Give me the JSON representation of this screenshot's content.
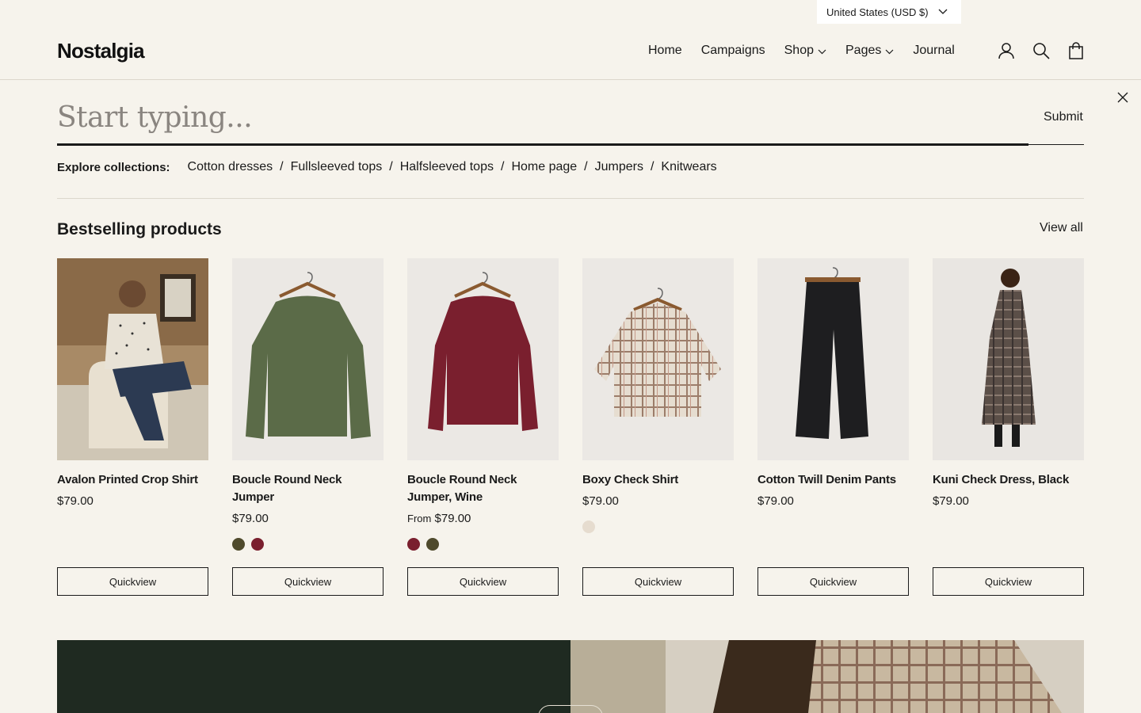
{
  "topbar": {
    "currency": "United States (USD $)"
  },
  "header": {
    "logo": "Nostalgia",
    "nav": [
      {
        "label": "Home",
        "dropdown": false
      },
      {
        "label": "Campaigns",
        "dropdown": false
      },
      {
        "label": "Shop",
        "dropdown": true
      },
      {
        "label": "Pages",
        "dropdown": true
      },
      {
        "label": "Journal",
        "dropdown": false
      }
    ],
    "icons": [
      "user-icon",
      "search-icon",
      "bag-icon"
    ]
  },
  "search": {
    "placeholder": "Start typing...",
    "submit_label": "Submit",
    "explore_label": "Explore collections:",
    "collections": [
      "Cotton dresses",
      "Fullsleeved tops",
      "Halfsleeved tops",
      "Home page",
      "Jumpers",
      "Knitwears"
    ]
  },
  "bestselling": {
    "title": "Bestselling products",
    "view_all": "View all",
    "quickview_label": "Quickview",
    "products": [
      {
        "name": "Avalon Printed Crop Shirt",
        "price_prefix": "",
        "price": "$79.00",
        "swatches": [],
        "image": "woman-in-printed-shirt-photo"
      },
      {
        "name": "Boucle Round Neck Jumper",
        "price_prefix": "",
        "price": "$79.00",
        "swatches": [
          "#4f4a2c",
          "#7a1f2e"
        ],
        "image": "green-sweater-on-hanger"
      },
      {
        "name": "Boucle Round Neck Jumper, Wine",
        "price_prefix": "From",
        "price": "$79.00",
        "swatches": [
          "#7a1f2e",
          "#4f4a2c"
        ],
        "image": "wine-sweater-on-hanger"
      },
      {
        "name": "Boxy Check Shirt",
        "price_prefix": "",
        "price": "$79.00",
        "swatches": [
          "#e6dccf"
        ],
        "image": "check-shirt-on-hanger"
      },
      {
        "name": "Cotton Twill Denim Pants",
        "price_prefix": "",
        "price": "$79.00",
        "swatches": [],
        "image": "black-pants-on-hanger"
      },
      {
        "name": "Kuni Check Dress, Black",
        "price_prefix": "",
        "price": "$79.00",
        "swatches": [],
        "image": "woman-in-check-dress-photo"
      }
    ]
  },
  "colors": {
    "background": "#f6f3ec",
    "text": "#1a1a1a",
    "banner_green": "#1f2a21"
  }
}
